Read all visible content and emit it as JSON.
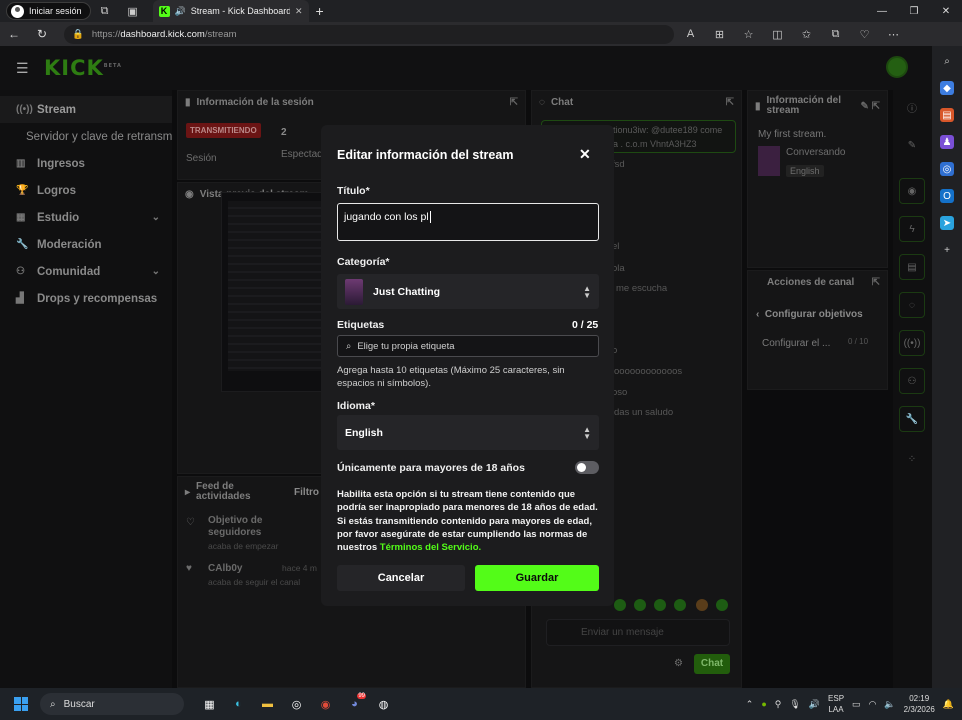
{
  "browser": {
    "signin_label": "Iniciar sesión",
    "tab_title": "Stream - Kick Dashboard",
    "url_scheme": "https://",
    "url_host": "dashboard.kick.com",
    "url_path": "/stream"
  },
  "kick": {
    "logo": "KICK",
    "logo_badge": "BETA"
  },
  "sidebar": {
    "items": [
      {
        "label": "Stream"
      },
      {
        "label": "Servidor y clave de retransm"
      },
      {
        "label": "Ingresos"
      },
      {
        "label": "Logros"
      },
      {
        "label": "Estudio"
      },
      {
        "label": "Moderación"
      },
      {
        "label": "Comunidad"
      },
      {
        "label": "Drops y recompensas"
      }
    ]
  },
  "background": {
    "session_info": "Información de la sesión",
    "live_badge": "TRANSMITIENDO",
    "session_label": "Sesión",
    "viewers_value": "2",
    "viewers_label": "Espectad",
    "preview_title": "Vista previa del stream",
    "chat_title": "Chat",
    "chat_pinned_1": "tionu3iw: @dutee189 come",
    "chat_pinned_2": "a . c.o.m VhntA3HZ3",
    "chat_lines": [
      "fsd",
      "el",
      "ola",
      "me escucha",
      "o",
      "oooooooooooos",
      "oso",
      "das un saludo"
    ],
    "chat_placeholder": "Enviar un mensaje",
    "chat_button": "Chat",
    "stream_info_title": "Información del stream",
    "stream_name": "My first stream.",
    "stream_category": "Conversando",
    "stream_language": "English",
    "channel_actions": "Acciones de canal",
    "configure_goals": "Configurar objetivos",
    "configure_short": "Configurar el ...",
    "goal_count": "0 / 10",
    "activity_feed": "Feed de actividades",
    "filter": "Filtro",
    "activity_1_title": "Objetivo de seguidores",
    "activity_1_sub": "acaba de empezar",
    "activity_2_title": "CAlb0y",
    "activity_2_time": "hace 4 m",
    "activity_2_sub": "acaba de seguir el canal"
  },
  "modal": {
    "title": "Editar información del stream",
    "title_label": "Título*",
    "title_value": "jugando con los pl",
    "category_label": "Categoría*",
    "category_value": "Just Chatting",
    "tags_label": "Etiquetas",
    "tags_count": "0 / 25",
    "tags_placeholder": "Elige tu propia etiqueta",
    "tags_help": "Agrega hasta 10 etiquetas (Máximo 25 caracteres, sin espacios ni símbolos).",
    "language_label": "Idioma*",
    "language_value": "English",
    "adult_label": "Únicamente para mayores de 18 años",
    "adult_desc": "Habilita esta opción si tu stream tiene contenido que podría ser inapropiado para menores de 18 años de edad. Si estás transmitiendo contenido para mayores de edad, por favor asegúrate de estar cumpliendo las normas de nuestros",
    "adult_link": "Términos del Servicio.",
    "cancel_label": "Cancelar",
    "save_label": "Guardar"
  },
  "taskbar": {
    "search_label": "Buscar",
    "lang_1": "ESP",
    "lang_2": "LAA",
    "time": "02:19",
    "date": "2/3/2026",
    "discord_badge": "99"
  },
  "colors": {
    "accent": "#53fc18",
    "live": "#6b1414",
    "modal_bg": "#1c1c1e"
  }
}
